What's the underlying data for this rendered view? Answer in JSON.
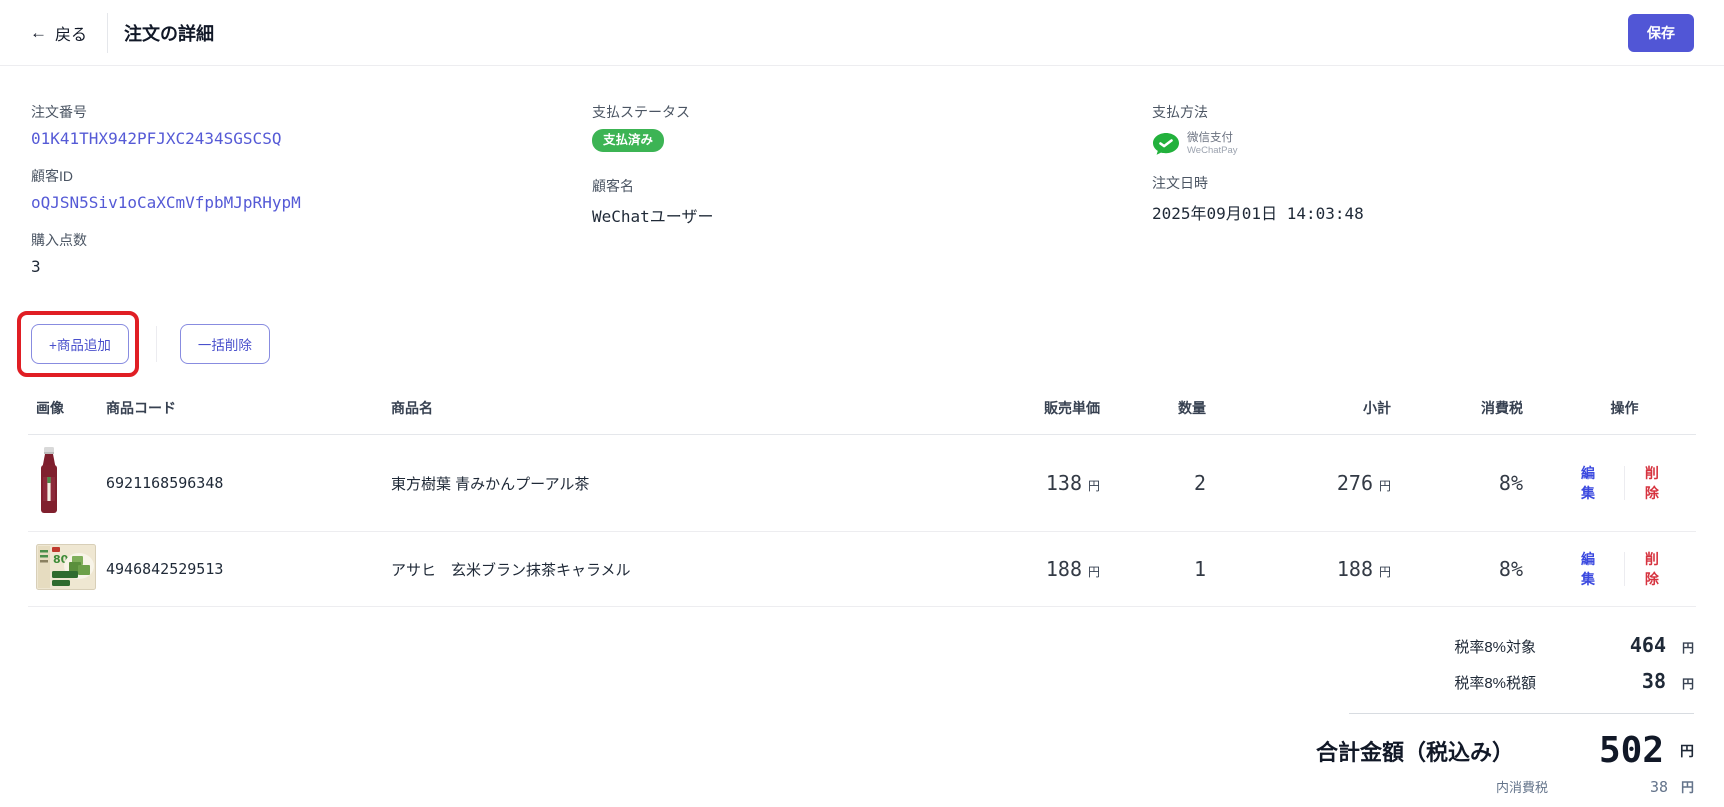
{
  "header": {
    "back_arrow": "←",
    "back_label": "戻る",
    "title": "注文の詳細",
    "save_label": "保存"
  },
  "order_info": {
    "order_number_label": "注文番号",
    "order_number": "01K41THX942PFJXC2434SGSCSQ",
    "customer_id_label": "顧客ID",
    "customer_id": "oQJSN5Siv1oCaXCmVfpbMJpRHypM",
    "purchase_count_label": "購入点数",
    "purchase_count": "3",
    "payment_status_label": "支払ステータス",
    "payment_status": "支払済み",
    "customer_name_label": "顧客名",
    "customer_name": "WeChatユーザー",
    "payment_method_label": "支払方法",
    "payment_method_name": "微信支付",
    "payment_method_sub": "WeChatPay",
    "order_datetime_label": "注文日時",
    "order_datetime": "2025年09月01日 14:03:48"
  },
  "toolbar": {
    "add_product_label": "+商品追加",
    "bulk_delete_label": "一括削除"
  },
  "table": {
    "headers": {
      "image": "画像",
      "code": "商品コード",
      "name": "商品名",
      "unit_price": "販売単価",
      "qty": "数量",
      "subtotal": "小計",
      "tax": "消費税",
      "ops": "操作"
    },
    "currency": "円",
    "edit_label": "編集",
    "delete_label": "削除",
    "rows": [
      {
        "code": "6921168596348",
        "name": "東方樹葉 青みかんプーアル茶",
        "unit_price": "138",
        "qty": "2",
        "subtotal": "276",
        "tax_rate": "8%"
      },
      {
        "code": "4946842529513",
        "name": "アサヒ　玄米ブラン抹茶キャラメル",
        "unit_price": "188",
        "qty": "1",
        "subtotal": "188",
        "tax_rate": "8%"
      }
    ]
  },
  "totals": {
    "tax_base_label": "税率8%対象",
    "tax_base": "464",
    "tax_amount_label": "税率8%税額",
    "tax_amount": "38",
    "grand_total_label": "合計金額（税込み）",
    "grand_total": "502",
    "included_tax_label": "内消費税",
    "included_tax": "38",
    "currency": "円"
  },
  "colors": {
    "accent_indigo": "#5156d6",
    "link_indigo": "#555ad6",
    "badge_green": "#3cb454",
    "wechat_green": "#22b13c",
    "delete_red": "#d6333f",
    "annotation_red": "#e01e24"
  }
}
